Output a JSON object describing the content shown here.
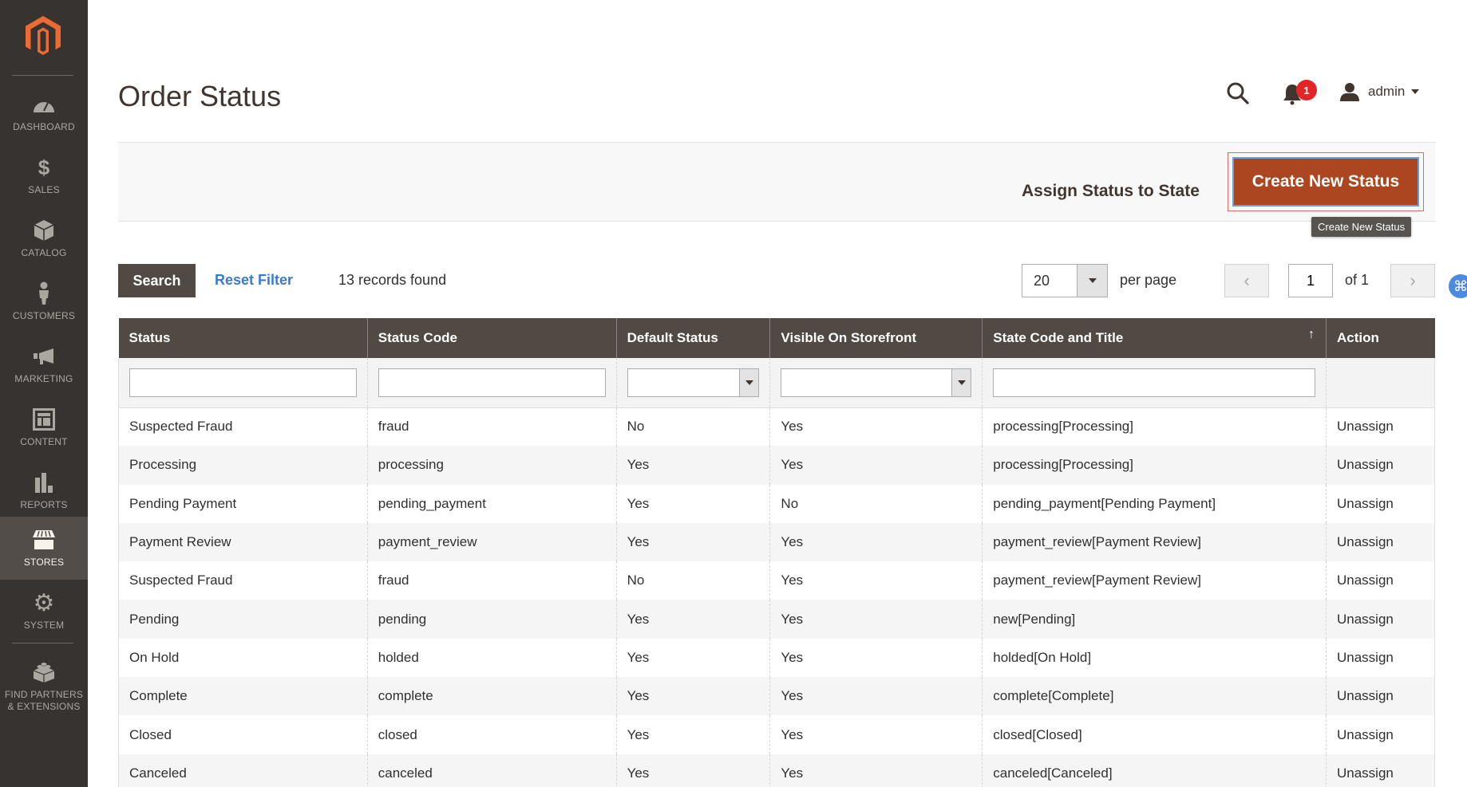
{
  "sidebar": {
    "logo": "magento-logo",
    "items": [
      {
        "label": "DASHBOARD",
        "icon": "dashboard-icon"
      },
      {
        "label": "SALES",
        "icon": "dollar-icon"
      },
      {
        "label": "CATALOG",
        "icon": "box-icon"
      },
      {
        "label": "CUSTOMERS",
        "icon": "person-icon"
      },
      {
        "label": "MARKETING",
        "icon": "megaphone-icon"
      },
      {
        "label": "CONTENT",
        "icon": "layout-icon"
      },
      {
        "label": "REPORTS",
        "icon": "bar-chart-icon"
      },
      {
        "label": "STORES",
        "icon": "storefront-icon",
        "active": true
      },
      {
        "label": "SYSTEM",
        "icon": "gear-icon"
      },
      {
        "label": "FIND PARTNERS & EXTENSIONS",
        "icon": "lego-block-icon"
      }
    ]
  },
  "header": {
    "title": "Order Status",
    "notifications_count": "1",
    "user_name": "admin"
  },
  "actions": {
    "assign_label": "Assign Status to State",
    "create_label": "Create New Status",
    "create_tooltip": "Create New Status"
  },
  "toolbar": {
    "search_label": "Search",
    "reset_label": "Reset Filter",
    "records_found": "13 records found",
    "per_page_value": "20",
    "per_page_label": "per page",
    "current_page": "1",
    "of_pages": "of 1",
    "prev_symbol": "‹",
    "next_symbol": "›",
    "extension_icon_glyph": "⌘"
  },
  "grid": {
    "columns": [
      "Status",
      "Status Code",
      "Default Status",
      "Visible On Storefront",
      "State Code and Title",
      "Action"
    ],
    "sort_indicator": "↑",
    "rows": [
      {
        "status": "Suspected Fraud",
        "code": "fraud",
        "default": "No",
        "visible": "Yes",
        "state": "processing[Processing]",
        "action": "Unassign"
      },
      {
        "status": "Processing",
        "code": "processing",
        "default": "Yes",
        "visible": "Yes",
        "state": "processing[Processing]",
        "action": "Unassign"
      },
      {
        "status": "Pending Payment",
        "code": "pending_payment",
        "default": "Yes",
        "visible": "No",
        "state": "pending_payment[Pending Payment]",
        "action": "Unassign"
      },
      {
        "status": "Payment Review",
        "code": "payment_review",
        "default": "Yes",
        "visible": "Yes",
        "state": "payment_review[Payment Review]",
        "action": "Unassign"
      },
      {
        "status": "Suspected Fraud",
        "code": "fraud",
        "default": "No",
        "visible": "Yes",
        "state": "payment_review[Payment Review]",
        "action": "Unassign"
      },
      {
        "status": "Pending",
        "code": "pending",
        "default": "Yes",
        "visible": "Yes",
        "state": "new[Pending]",
        "action": "Unassign"
      },
      {
        "status": "On Hold",
        "code": "holded",
        "default": "Yes",
        "visible": "Yes",
        "state": "holded[On Hold]",
        "action": "Unassign"
      },
      {
        "status": "Complete",
        "code": "complete",
        "default": "Yes",
        "visible": "Yes",
        "state": "complete[Complete]",
        "action": "Unassign"
      },
      {
        "status": "Closed",
        "code": "closed",
        "default": "Yes",
        "visible": "Yes",
        "state": "closed[Closed]",
        "action": "Unassign"
      },
      {
        "status": "Canceled",
        "code": "canceled",
        "default": "Yes",
        "visible": "Yes",
        "state": "canceled[Canceled]",
        "action": "Unassign"
      }
    ]
  },
  "colors": {
    "sidebar_bg": "#373330",
    "sidebar_active": "#524d49",
    "accent_orange": "#ab4620",
    "logo_orange": "#eb6b33",
    "link_blue": "#3a7ad4",
    "header_row": "#514943",
    "badge_red": "#e22626"
  }
}
